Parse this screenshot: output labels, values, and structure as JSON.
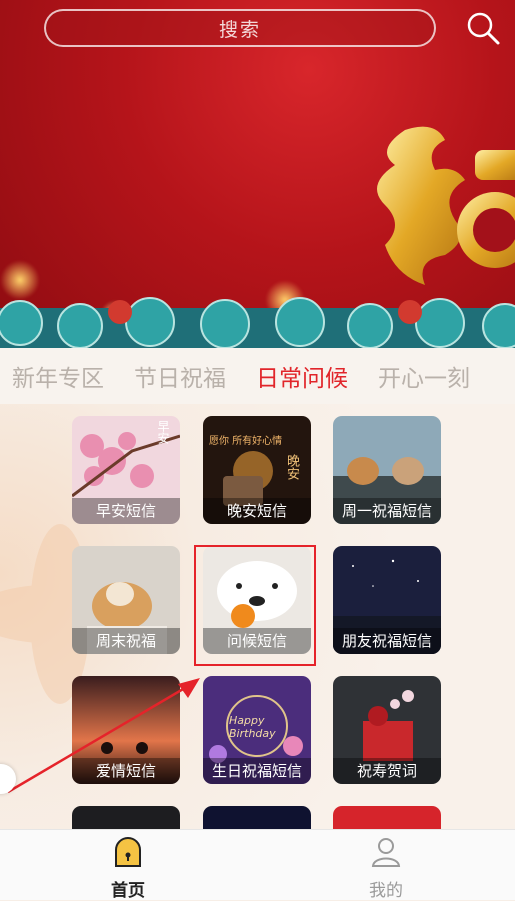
{
  "search": {
    "placeholder": "搜索"
  },
  "tabs": [
    {
      "label": "新年专区"
    },
    {
      "label": "节日祝福"
    },
    {
      "label": "日常问候",
      "active": true
    },
    {
      "label": "开心一刻"
    }
  ],
  "cards": [
    {
      "label": "早安短信",
      "bg": "#e9b7c8",
      "img_text": "早安"
    },
    {
      "label": "晚安短信",
      "bg": "#2c1a12",
      "img_text": "晚安",
      "overlay_text": "愿你 所有好心情"
    },
    {
      "label": "周一祝福短信",
      "bg": "#8aa6b8"
    },
    {
      "label": "周末祝福",
      "bg": "#cfc8c0"
    },
    {
      "label": "问候短信",
      "bg": "#e8e4df"
    },
    {
      "label": "朋友祝福短信",
      "bg": "#1c2140"
    },
    {
      "label": "爱情短信",
      "bg": "#5b2b27"
    },
    {
      "label": "生日祝福短信",
      "bg": "#4a2c7a",
      "img_text": "Happy Birthday"
    },
    {
      "label": "祝寿贺词",
      "bg": "#2e3135"
    }
  ],
  "nav": {
    "home": "首页",
    "me": "我的"
  },
  "colors": {
    "accent": "#e1252a",
    "banner": "#b5141a"
  }
}
